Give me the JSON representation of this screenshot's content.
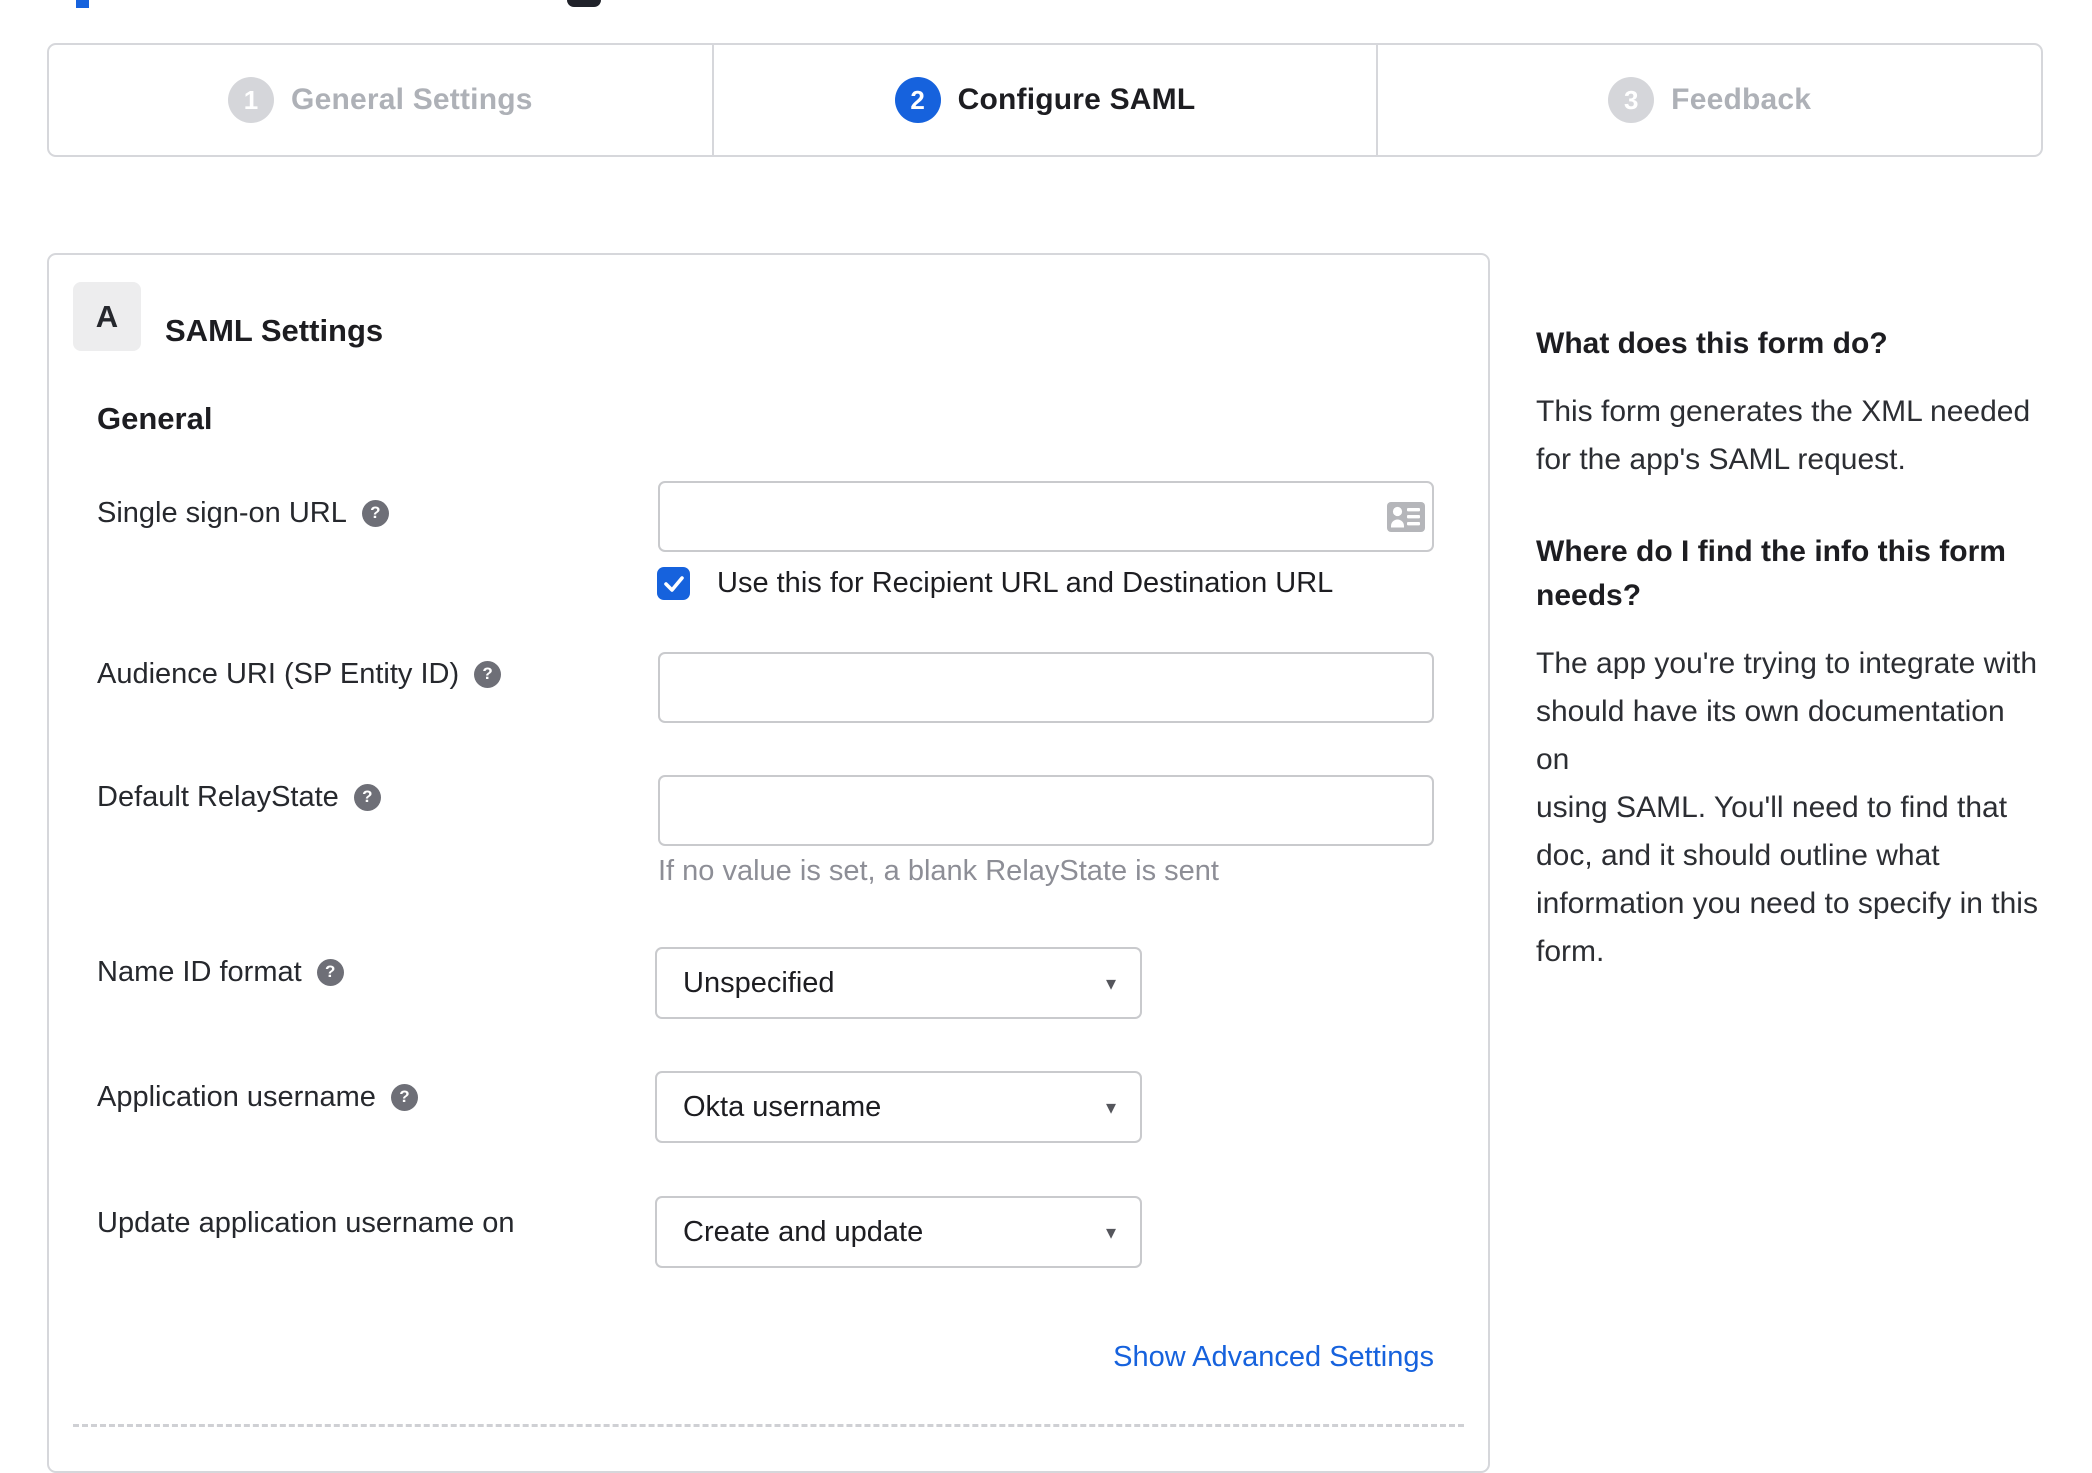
{
  "colors": {
    "accent_blue": "#1662dd",
    "inactive_gray": "#d5d6da",
    "step_inactive_text": "#aeb1b7",
    "text_dark": "#1d1d21",
    "border_gray": "#d6d7db",
    "hint_gray": "#8d8e96",
    "help_icon_gray": "#6e6f77"
  },
  "icons": {
    "help_glyph": "?",
    "dropdown_glyph": "▾"
  },
  "stepper": {
    "steps": [
      {
        "number": "1",
        "label": "General Settings",
        "state": "inactive"
      },
      {
        "number": "2",
        "label": "Configure SAML",
        "state": "active"
      },
      {
        "number": "3",
        "label": "Feedback",
        "state": "inactive"
      }
    ]
  },
  "form": {
    "badge": "A",
    "title": "SAML Settings",
    "group_heading": "General",
    "rows": {
      "sso": {
        "label": "Single sign-on URL",
        "value": "",
        "checkbox_label": "Use this for Recipient URL and Destination URL",
        "checkbox_checked": true
      },
      "audience": {
        "label": "Audience URI (SP Entity ID)",
        "value": ""
      },
      "relay": {
        "label": "Default RelayState",
        "value": "",
        "hint": "If no value is set, a blank RelayState is sent"
      },
      "nameid": {
        "label": "Name ID format",
        "value": "Unspecified"
      },
      "appuser": {
        "label": "Application username",
        "value": "Okta username"
      },
      "updateuser": {
        "label": "Update application username on",
        "value": "Create and update"
      }
    },
    "advanced_link": "Show Advanced Settings"
  },
  "sidebar": {
    "what": {
      "heading": "What does this form do?",
      "body_lines": [
        "This form generates the XML needed",
        "for the app's SAML request."
      ]
    },
    "where": {
      "heading_lines": [
        "Where do I find the info this form",
        "needs?"
      ],
      "body_lines": [
        "The app you're trying to integrate with",
        "should have its own documentation on",
        "using SAML. You'll need to find that",
        "doc, and it should outline what",
        "information you need to specify in this",
        "form."
      ]
    }
  }
}
